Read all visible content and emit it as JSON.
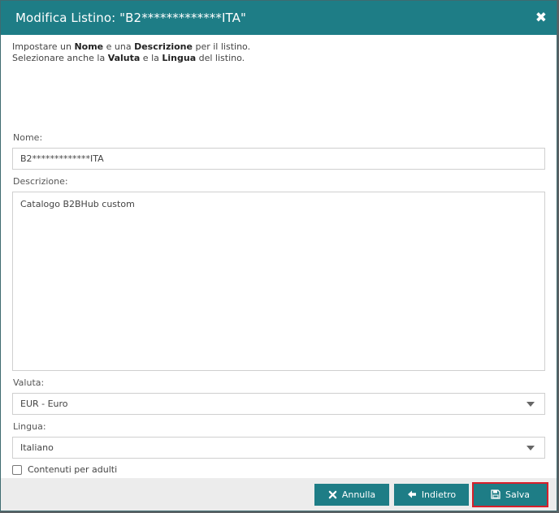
{
  "modal": {
    "title": "Modifica Listino: \"B2*************ITA\"",
    "close_glyph": "✖"
  },
  "intro": {
    "line1_a": "Impostare un ",
    "line1_b": "Nome",
    "line1_c": " e una ",
    "line1_d": "Descrizione",
    "line1_e": " per il listino.",
    "line2_a": "Selezionare anche la ",
    "line2_b": "Valuta",
    "line2_c": " e la ",
    "line2_d": "Lingua",
    "line2_e": " del listino."
  },
  "form": {
    "name_label": "Nome:",
    "name_value": "B2*************ITA",
    "description_label": "Descrizione:",
    "description_value": "Catalogo B2BHub custom",
    "currency_label": "Valuta:",
    "currency_value": "EUR - Euro",
    "language_label": "Lingua:",
    "language_value": "Italiano",
    "adult_label": "Contenuti per adulti"
  },
  "footer": {
    "cancel_label": "Annulla",
    "back_label": "Indietro",
    "save_label": "Salva"
  },
  "colors": {
    "header": "#1e7d86",
    "button": "#1e7d86",
    "highlight": "#d81f2a"
  },
  "icons": {
    "close": "close-icon",
    "cancel": "x-icon",
    "back": "arrow-left-icon",
    "save": "floppy-disk-icon"
  }
}
